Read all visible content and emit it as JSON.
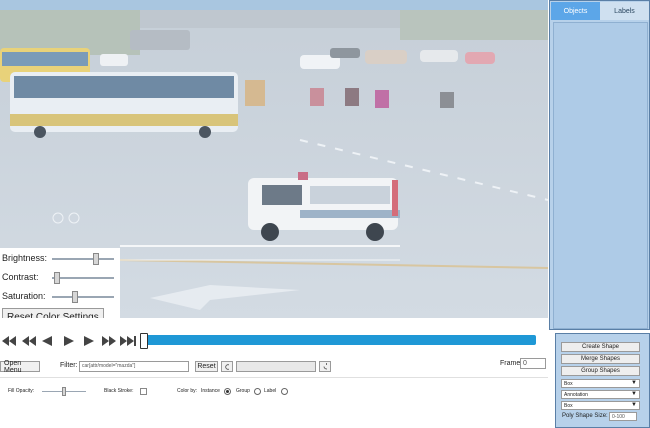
{
  "sidebar_tabs": [
    "Objects",
    "Labels"
  ],
  "color_settings": {
    "brightness_label": "Brightness:",
    "contrast_label": "Contrast:",
    "saturation_label": "Saturation:",
    "brightness_value": 0.7,
    "contrast_value": 0.03,
    "saturation_value": 0.35,
    "reset_label": "Reset Color Settings"
  },
  "player": {
    "icons": [
      "first-frame-icon",
      "fast-backward-icon",
      "step-backward-icon",
      "play-icon",
      "step-forward-icon",
      "fast-forward-icon",
      "last-frame-icon"
    ],
    "progress": 0.0
  },
  "toolbar": {
    "open_menu_label": "Open Menu",
    "filter_label": "Filter:",
    "filter_value": "car[attr/model=\"mazda\"]",
    "reset_label": "Reset",
    "frame_label": "Frame",
    "frame_value": "0"
  },
  "options": {
    "fill_opacity_label": "Fill Opacity:",
    "black_stroke_label": "Black Stroke:",
    "color_by_label": "Color by:",
    "color_by_options": [
      "Instance",
      "Group",
      "Label"
    ],
    "color_by_selected": "Instance"
  },
  "shape_panel": {
    "create_shape_label": "Create Shape",
    "merge_shapes_label": "Merge Shapes",
    "group_shapes_label": "Group Shapes",
    "shape_type_value": "Box",
    "mode_value": "Annotation",
    "label_value": "Box",
    "poly_size_label": "Poly Shape Size:",
    "poly_size_value": "0-100"
  },
  "colors": {
    "accent": "#1f98d6",
    "panel": "#b7d1ea",
    "tab_active": "#5ca6e8"
  }
}
